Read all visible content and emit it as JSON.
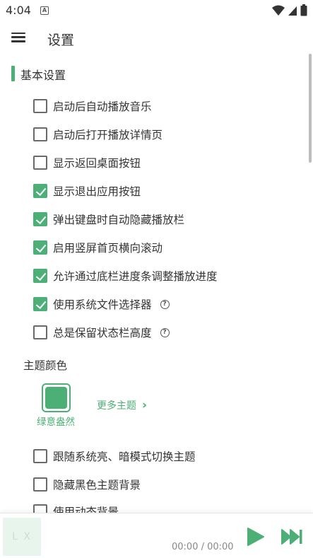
{
  "status_bar": {
    "time": "4:04",
    "notification_letter": "A",
    "icons": [
      "wifi-icon",
      "signal-icon",
      "battery-icon"
    ]
  },
  "app_bar": {
    "title": "设置",
    "menu_icon": "menu-icon"
  },
  "section": {
    "title": "基本设置"
  },
  "options": [
    {
      "label": "启动后自动播放音乐",
      "checked": false,
      "help": false
    },
    {
      "label": "启动后打开播放详情页",
      "checked": false,
      "help": false
    },
    {
      "label": "显示返回桌面按钮",
      "checked": false,
      "help": false
    },
    {
      "label": "显示退出应用按钮",
      "checked": true,
      "help": false
    },
    {
      "label": "弹出键盘时自动隐藏播放栏",
      "checked": true,
      "help": false
    },
    {
      "label": "启用竖屏首页横向滚动",
      "checked": true,
      "help": false
    },
    {
      "label": "允许通过底栏进度条调整播放进度",
      "checked": true,
      "help": false
    },
    {
      "label": "使用系统文件选择器",
      "checked": true,
      "help": true
    },
    {
      "label": "总是保留状态栏高度",
      "checked": false,
      "help": true
    }
  ],
  "theme": {
    "title": "主题颜色",
    "current_name": "绿意盎然",
    "more_label": "更多主题",
    "accent_color": "#4caf76"
  },
  "options_after_theme": [
    {
      "label": "跟随系统亮、暗模式切换主题",
      "checked": false
    },
    {
      "label": "隐藏黑色主题背景",
      "checked": false
    },
    {
      "label": "使用动态背景",
      "checked": false
    }
  ],
  "help_glyph": "?",
  "player": {
    "cover_text": "L X",
    "time_text": "00:00 / 00:00",
    "play_icon": "play-icon",
    "next_icon": "skip-next-icon"
  }
}
